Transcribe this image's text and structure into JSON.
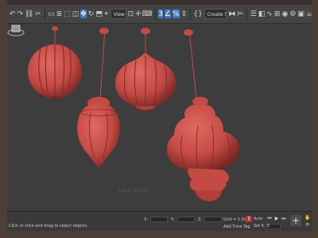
{
  "toolbar": {
    "selection_set_dropdown": "Create Selection Set",
    "buttons": [
      "undo-icon",
      "redo-icon",
      "link-icon",
      "unlink-icon",
      "bind-space-warp-icon",
      "select-object-icon",
      "select-by-name-icon",
      "select-region-icon",
      "window-crossing-icon",
      "move-icon",
      "rotate-icon",
      "scale-icon",
      "place-icon",
      "reference-coord-icon",
      "pivot-icon",
      "select-manipulate-icon",
      "keyboard-shortcut-icon",
      "snaps-toggle-icon",
      "angle-snap-icon",
      "percent-snap-icon",
      "spinner-snap-icon",
      "edit-named-selections-icon",
      "mirror-icon",
      "align-icon",
      "toggle-scene-explorer-icon",
      "layer-explorer-icon",
      "curve-editor-icon",
      "schematic-view-icon",
      "material-editor-icon",
      "render-setup-icon",
      "rendered-frame-window-icon",
      "render-icon"
    ]
  },
  "viewport": {
    "background": "#3d3d3d",
    "object_color": "#c44a44",
    "watermark": "Lamp model"
  },
  "statusbar": {
    "prompt": "Click or click-and-drag to select objects",
    "x_label": "X:",
    "y_label": "Y:",
    "z_label": "Z:",
    "grid": "Grid = 1.0cm",
    "add_time_tag": "Add Time Tag",
    "frame_value": "0",
    "auto_key": "Auto",
    "set_key": "Set K."
  },
  "colors": {
    "frame": "#4b3f38",
    "toolbar": "#444444",
    "accent": "#3d7ac9",
    "key_red": "#b33333"
  }
}
